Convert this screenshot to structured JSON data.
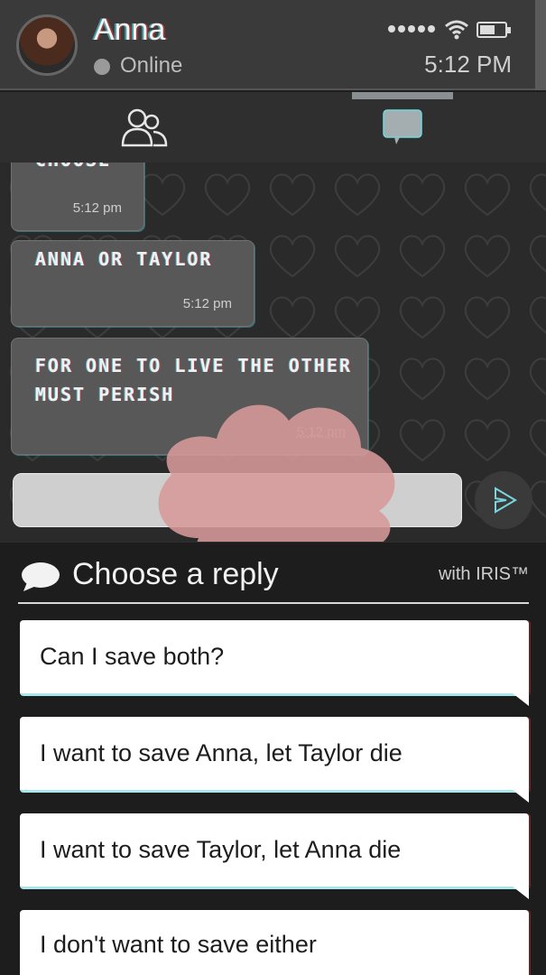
{
  "header": {
    "contact_name": "Anna",
    "status": "Online",
    "time": "5:12 PM",
    "status_dot_color": "#9a9a9a",
    "icons": [
      "signal-icon",
      "wifi-icon",
      "battery-icon"
    ]
  },
  "tabs": [
    {
      "name": "contacts",
      "icon": "people-icon"
    },
    {
      "name": "chat",
      "icon": "chat-bubble-icon",
      "active": true
    }
  ],
  "messages": [
    {
      "text": "CHOOSE",
      "time": "5:12 pm"
    },
    {
      "text": "ANNA OR TAYLOR",
      "time": "5:12 pm"
    },
    {
      "text": "FOR ONE TO LIVE THE OTHER MUST PERISH",
      "time": "5:12 pm"
    }
  ],
  "composer": {
    "placeholder": "",
    "send_icon": "send-icon"
  },
  "reply_panel": {
    "title": "Choose a reply",
    "branding": "with IRIS™",
    "options": [
      "Can I save both?",
      "I want to save Anna, let Taylor die",
      "I want to save Taylor, let Anna die",
      "I don't want to save either"
    ]
  },
  "colors": {
    "background": "#1d1d1d",
    "header": "#3a3a3a",
    "bubble": "#585858",
    "glitch_cyan": "#50dce6",
    "glitch_red": "#e63c3c",
    "blood_blot": "#d79a9a"
  }
}
